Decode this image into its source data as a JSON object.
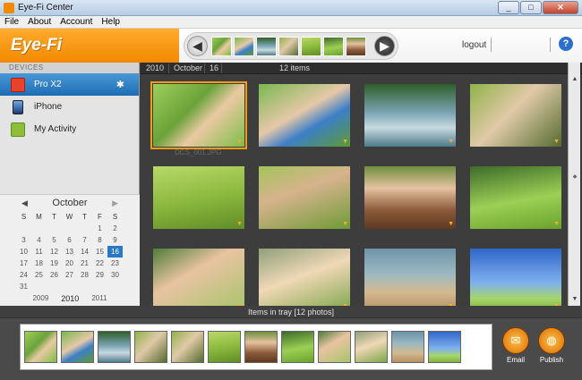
{
  "window": {
    "title": "Eye-Fi Center"
  },
  "menu": [
    "File",
    "About",
    "Account",
    "Help"
  ],
  "header": {
    "logo": "Eye-Fi",
    "logout": "logout",
    "help": "?"
  },
  "sidebar": {
    "section_label": "DEVICES",
    "devices": [
      {
        "label": "Pro X2",
        "icon": "wifi-card-icon"
      },
      {
        "label": "iPhone",
        "icon": "phone-icon"
      },
      {
        "label": "My Activity",
        "icon": "activity-icon"
      }
    ]
  },
  "calendar": {
    "month": "October",
    "weekdays": [
      "S",
      "M",
      "T",
      "W",
      "T",
      "F",
      "S"
    ],
    "days": [
      "",
      "",
      "",
      "",
      "",
      "1",
      "2",
      "3",
      "4",
      "5",
      "6",
      "7",
      "8",
      "9",
      "10",
      "11",
      "12",
      "13",
      "14",
      "15",
      "16",
      "17",
      "18",
      "19",
      "20",
      "21",
      "22",
      "23",
      "24",
      "25",
      "26",
      "27",
      "28",
      "29",
      "30",
      "31",
      "",
      "",
      "",
      "",
      "",
      ""
    ],
    "selected_day": "16",
    "years": [
      "2009",
      "2010",
      "2011"
    ],
    "current_year": "2010"
  },
  "breadcrumb": {
    "year": "2010",
    "month": "October",
    "day": "16",
    "count": "12 items"
  },
  "photos": [
    {
      "caption": "DCS_001.JPG",
      "selected": true
    },
    {
      "caption": "",
      "selected": false
    },
    {
      "caption": "",
      "selected": false
    },
    {
      "caption": "",
      "selected": false
    },
    {
      "caption": "",
      "selected": false
    },
    {
      "caption": "",
      "selected": false
    },
    {
      "caption": "",
      "selected": false
    },
    {
      "caption": "",
      "selected": false
    },
    {
      "caption": "",
      "selected": false
    },
    {
      "caption": "",
      "selected": false
    },
    {
      "caption": "",
      "selected": false
    },
    {
      "caption": "",
      "selected": false
    }
  ],
  "tray": {
    "label": "Items in tray [12 photos]",
    "count": 12
  },
  "actions": {
    "email": "Email",
    "publish": "Publish"
  },
  "colors": {
    "accent_orange": "#f28900",
    "selection_blue": "#1d6cb4",
    "selection_outline": "#f49a16"
  }
}
